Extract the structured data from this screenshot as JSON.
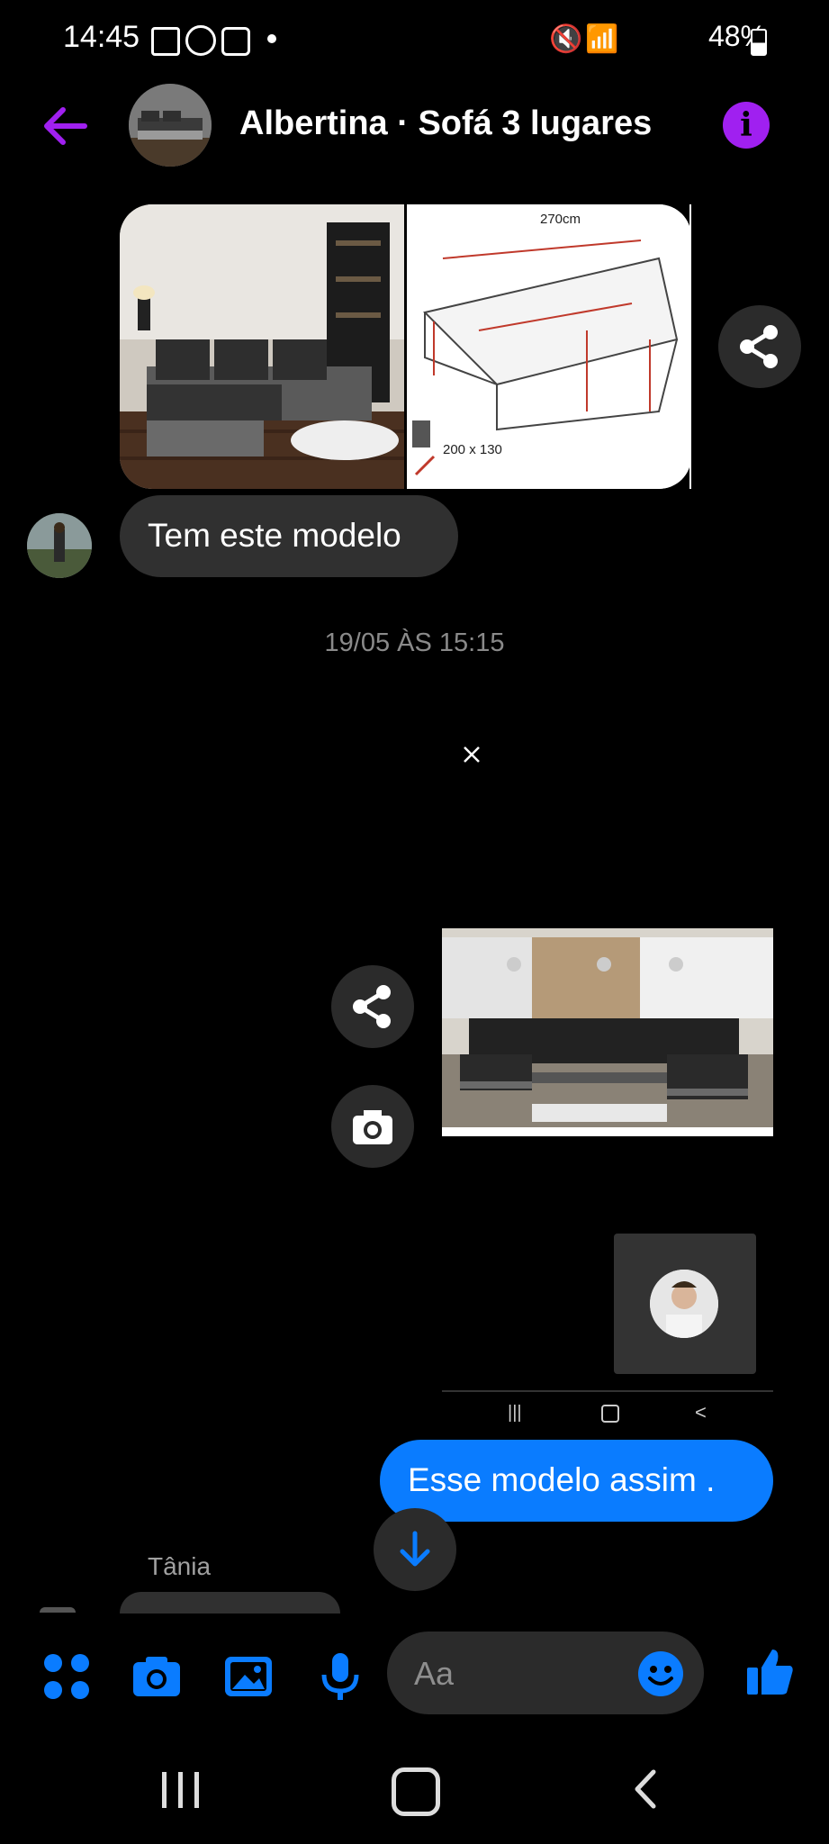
{
  "status_bar": {
    "time": "14:45",
    "battery": "48%"
  },
  "header": {
    "title": "Albertina · Sofá 3 lugares",
    "info_label": "i"
  },
  "messages": {
    "first_text": "Tem este modelo",
    "timestamp": "19/05 ÀS 15:15",
    "sketch_label_total": "270cm",
    "sketch_label_bed": "200 x 130",
    "reply_text": "Esse modelo assim .",
    "next_sender": "Tânia"
  },
  "composer": {
    "placeholder": "Aa"
  },
  "colors": {
    "accent_purple": "#a020f0",
    "accent_blue": "#0a7cff",
    "bubble_gray": "#303030"
  },
  "icons": [
    "back-arrow-icon",
    "info-icon",
    "share-icon",
    "camera-icon",
    "close-icon",
    "scroll-down-icon",
    "apps-icon",
    "image-icon",
    "mic-icon",
    "emoji-icon",
    "thumbs-up-icon"
  ]
}
